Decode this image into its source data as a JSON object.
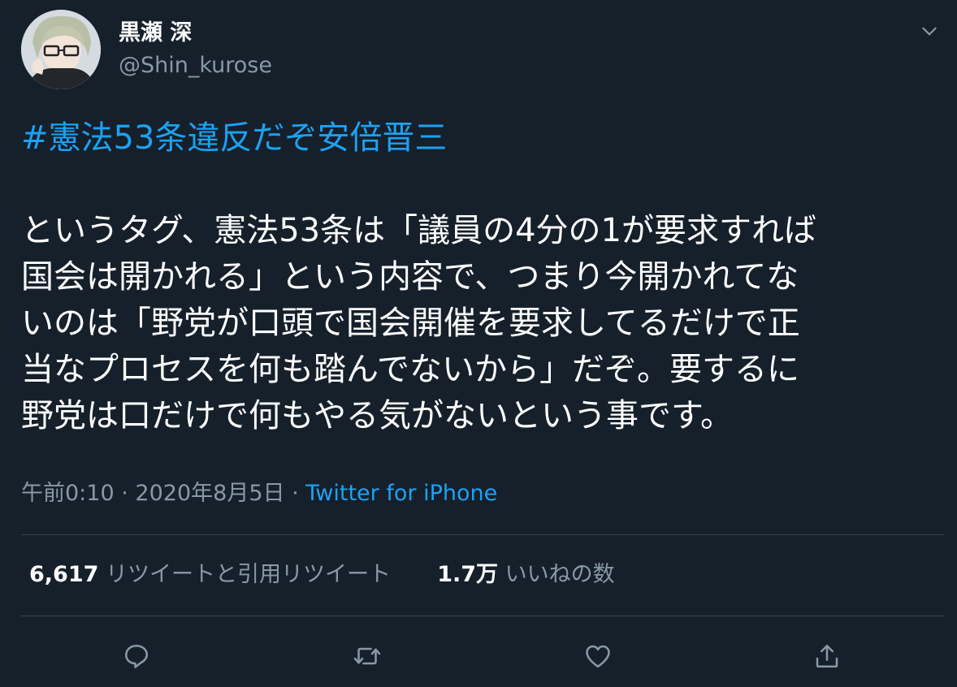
{
  "user": {
    "display_name": "黒瀬 深",
    "handle": "@Shin_kurose"
  },
  "tweet": {
    "hashtag": "#憲法53条違反だぞ安倍晋三",
    "lines": [
      "というタグ、憲法53条は「議員の4分の1が要求すれば",
      "国会は開かれる」という内容で、つまり今開かれてな",
      "いのは「野党が口頭で国会開催を要求してるだけで正",
      "当なプロセスを何も踏んでないから」だぞ。要するに",
      "野党は口だけで何もやる気がないという事です。"
    ],
    "time": "午前0:10",
    "separator": "·",
    "date": "2020年8月5日",
    "source": "Twitter for iPhone"
  },
  "stats": {
    "retweets_count": "6,617",
    "retweets_label": "リツイートと引用リツイート",
    "likes_count": "1.7万",
    "likes_label": "いいねの数"
  },
  "icons": {
    "more": "chevron-down-icon",
    "reply": "reply-icon",
    "retweet": "retweet-icon",
    "like": "heart-icon",
    "share": "share-icon"
  },
  "colors": {
    "background": "#15202b",
    "accent": "#1da1f2",
    "secondary_text": "#8899a6",
    "divider": "#38444d"
  }
}
